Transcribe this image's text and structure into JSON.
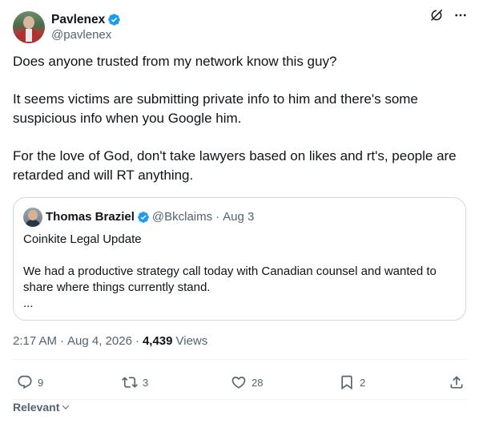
{
  "author": {
    "display_name": "Pavlenex",
    "handle": "@pavlenex",
    "verified": true
  },
  "tweet": {
    "paragraphs": [
      "Does anyone trusted from my network know this guy?",
      "It seems victims are submitting private info to him and there's some suspicious info when you Google him.",
      "For the love of God, don't take lawyers based on likes and rt's, people are retarded and will RT anything."
    ]
  },
  "quote": {
    "display_name": "Thomas Braziel",
    "handle": "@Bkclaims",
    "separator": "·",
    "date": "Aug 3",
    "title": "Coinkite Legal Update",
    "body": "We had a productive strategy call today with Canadian counsel and wanted to share where things currently stand.",
    "ellipsis": "..."
  },
  "meta": {
    "time": "2:17 AM",
    "separator": "·",
    "date": "Aug 4, 2026",
    "views_count": "4,439",
    "views_label": "Views"
  },
  "actions": {
    "replies": "9",
    "reposts": "3",
    "likes": "28",
    "bookmarks": "2"
  },
  "sort": {
    "label": "Relevant"
  },
  "colors": {
    "verified": "#1d9bf0",
    "text": "#0f1419",
    "secondary": "#536471",
    "border": "#cfd9de"
  },
  "icons": [
    "verified-badge-icon",
    "grok-icon",
    "more-icon",
    "reply-icon",
    "repost-icon",
    "like-icon",
    "bookmark-icon",
    "share-icon",
    "chevron-down-icon"
  ]
}
